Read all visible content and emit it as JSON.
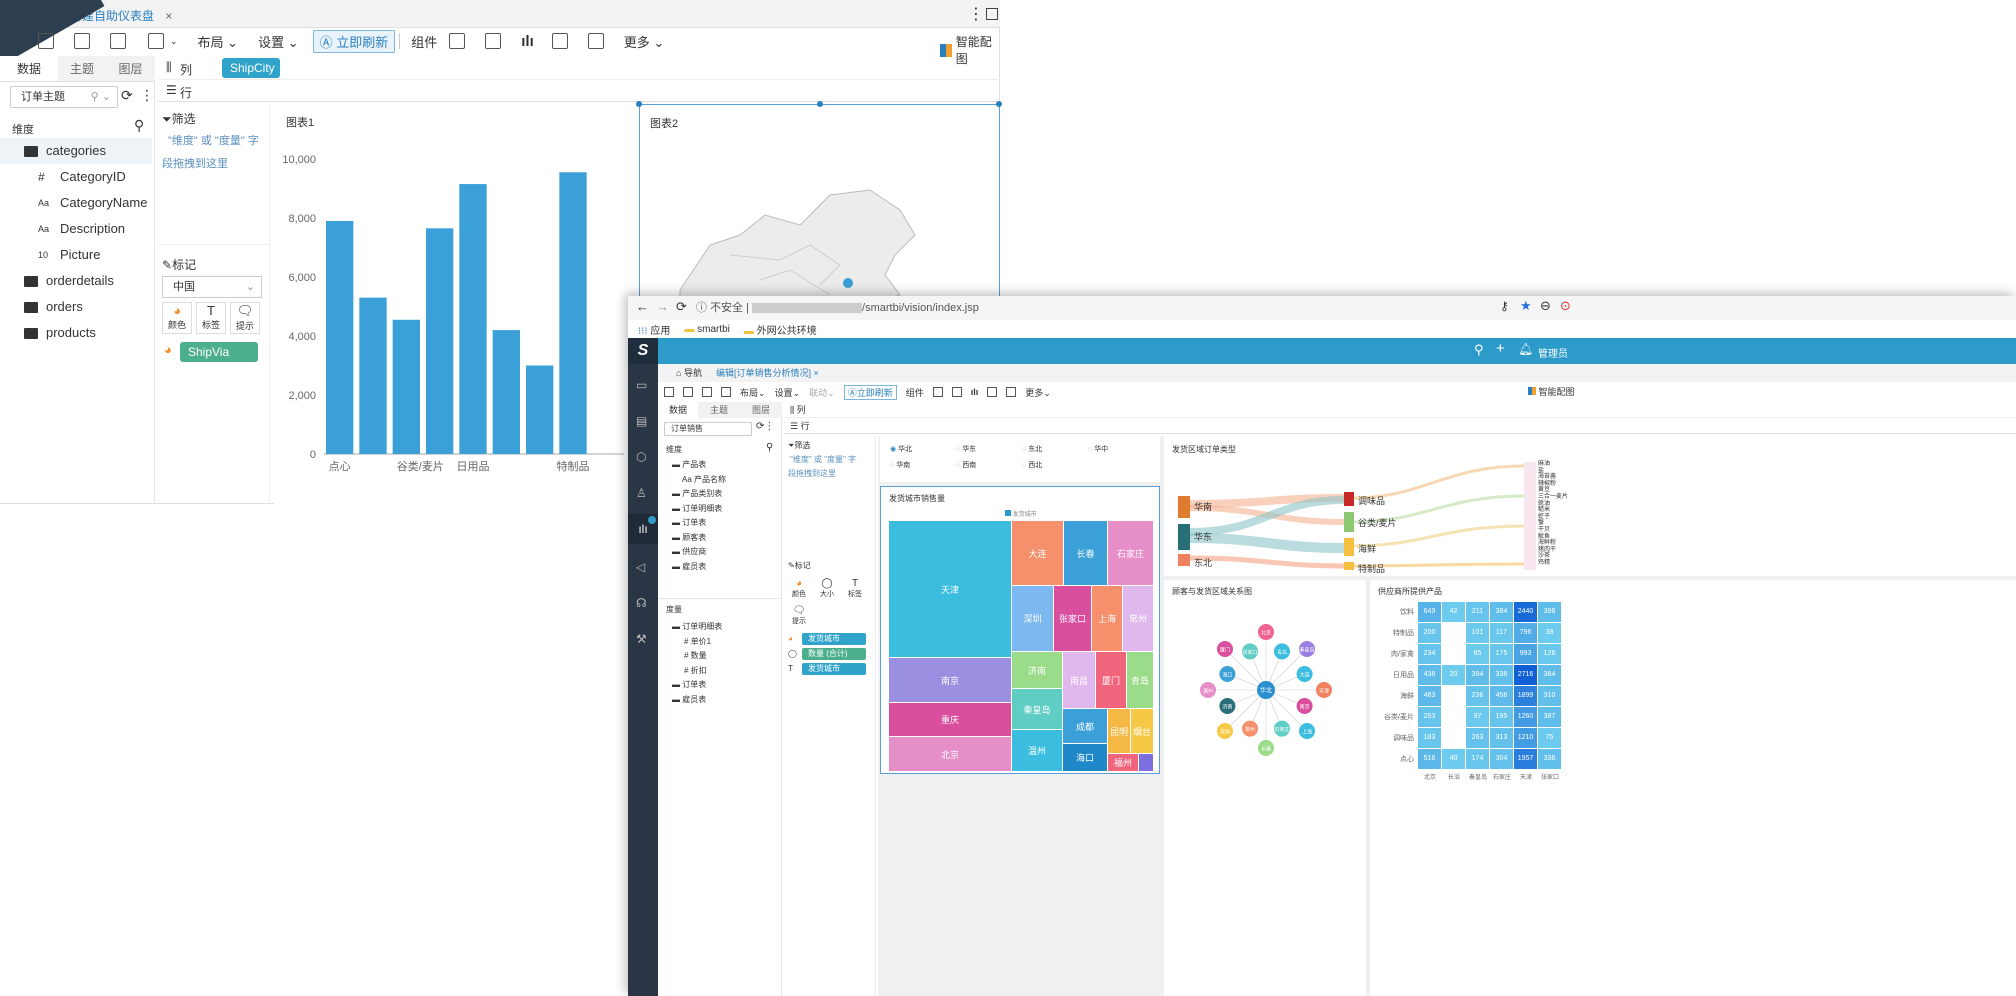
{
  "w1": {
    "tab": "新建自助仪表盘",
    "tab_close": "×",
    "toolbar": {
      "layout": "布局",
      "settings": "设置",
      "refresh": "立即刷新",
      "component": "组件",
      "more": "更多",
      "smart": "智能配图"
    },
    "left_tabs": [
      "数据",
      "主题",
      "图层"
    ],
    "topic": "订单主题",
    "dim_title": "维度",
    "tree": [
      {
        "label": "categories",
        "type": "folder"
      },
      {
        "label": "CategoryID",
        "type": "#"
      },
      {
        "label": "CategoryName",
        "type": "Aa"
      },
      {
        "label": "Description",
        "type": "Aa"
      },
      {
        "label": "Picture",
        "type": "10"
      },
      {
        "label": "orderdetails",
        "type": "folder"
      },
      {
        "label": "orders",
        "type": "folder"
      },
      {
        "label": "products",
        "type": "folder"
      }
    ],
    "cols_label": "列",
    "rows_label": "行",
    "col_pill": "ShipCity",
    "filter": {
      "title": "筛选",
      "hint1": "\"维度\" 或 \"度量\" 字",
      "hint2": "段拖拽到这里"
    },
    "mark": {
      "title": "标记",
      "select": "中国",
      "buttons": [
        "颜色",
        "标签",
        "提示"
      ],
      "pill": "ShipVia (合..."
    },
    "chart1_title": "图表1",
    "chart2_title": "图表2"
  },
  "chart_data": {
    "type": "bar",
    "categories": [
      "点心",
      "",
      "谷类/麦片",
      "",
      "日用品",
      "",
      "",
      "特制品",
      ""
    ],
    "values": [
      7900,
      5300,
      4550,
      7650,
      9150,
      4200,
      3000,
      9550,
      0
    ],
    "ylim": [
      0,
      10000
    ],
    "yticks": [
      "10,000",
      "8,000",
      "6,000",
      "4,000",
      "2,000",
      "0"
    ],
    "color": "#3ba0d8"
  },
  "browser": {
    "security": "不安全",
    "url": "/smartbi/vision/index.jsp",
    "bookmarks": [
      "应用",
      "smartbi",
      "外网公共环境"
    ]
  },
  "w2": {
    "header_right": "管理员",
    "nav": "导航",
    "tab": "编辑[订单销售分析情况]",
    "toolbar": {
      "layout": "布局",
      "settings": "设置",
      "linkage": "联动",
      "refresh": "立即刷新",
      "component": "组件",
      "more": "更多",
      "smart": "智能配图"
    },
    "left_tabs": [
      "数据",
      "主题",
      "图层"
    ],
    "topic": "订单销售",
    "dim_title": "维度",
    "tree": [
      "产品表",
      "产品名称",
      "产品类别表",
      "订单明细表",
      "订单表",
      "顾客表",
      "供应商",
      "雇员表"
    ],
    "measure_title": "度量",
    "mtree": [
      "订单明细表",
      "单价1",
      "数量",
      "折扣",
      "订单表",
      "雇员表"
    ],
    "cols_label": "列",
    "rows_label": "行",
    "filter": {
      "title": "筛选",
      "hint1": "\"维度\" 或 \"度量\" 字",
      "hint2": "段拖拽到这里"
    },
    "mark": {
      "title": "标记",
      "buttons": [
        "颜色",
        "大小",
        "标签",
        "提示"
      ],
      "pills": [
        "发货城市",
        "数量 (合计)",
        "发货城市"
      ]
    },
    "regions": [
      "华北",
      "华东",
      "东北",
      "华中",
      "华南",
      "西南",
      "西北"
    ],
    "treemap": {
      "title": "发货城市销售量",
      "legend": "发货城市",
      "cells": [
        "天津",
        "南京",
        "重庆",
        "北京",
        "大连",
        "长春",
        "石家庄",
        "深圳",
        "张家口",
        "上海",
        "常州",
        "济南",
        "秦皇岛",
        "南昌",
        "厦门",
        "青岛",
        "温州",
        "成都",
        "海口",
        "昆明",
        "烟台",
        "福州"
      ]
    },
    "sankey": {
      "title": "发货区域订单类型",
      "left": [
        "华南",
        "华东",
        "东北"
      ],
      "mid": [
        "调味品",
        "谷类/麦片",
        "海鲜",
        "特制品"
      ],
      "right": [
        "麻油",
        "盐",
        "海苔酱",
        "辣椒粉",
        "黄豆",
        "三合一麦片",
        "蚝油",
        "糙米",
        "虾子",
        "蟹",
        "干贝",
        "鱿鱼",
        "海鲜粉",
        "猪肉干",
        "沙茶",
        "鸡精"
      ]
    },
    "graph": {
      "title": "顾客与发货区域关系图",
      "center": "华北",
      "nodes": [
        "北京",
        "青岛",
        "秦皇岛",
        "大连",
        "天津",
        "南京",
        "上海",
        "石家庄",
        "长春",
        "常州",
        "深圳",
        "济南",
        "温州",
        "海口",
        "厦门",
        "张家口"
      ]
    },
    "heatmap": {
      "title": "供应商所提供产品",
      "rows": [
        [
          "饮料",
          "649",
          "42",
          "211",
          "384",
          "2440",
          "398"
        ],
        [
          "特制品",
          "200",
          "",
          "101",
          "117",
          "796",
          "38"
        ],
        [
          "肉/家禽",
          "234",
          "",
          "65",
          "175",
          "993",
          "126"
        ],
        [
          "日用品",
          "438",
          "20",
          "394",
          "338",
          "2716",
          "384"
        ],
        [
          "海鲜",
          "483",
          "",
          "236",
          "456",
          "1899",
          "310"
        ],
        [
          "谷类/麦片",
          "253",
          "",
          "97",
          "195",
          "1260",
          "387"
        ],
        [
          "调味品",
          "183",
          "",
          "263",
          "313",
          "1210",
          "75"
        ],
        [
          "点心",
          "516",
          "40",
          "174",
          "304",
          "1957",
          "336"
        ]
      ],
      "cols": [
        "北京",
        "长治",
        "秦皇岛",
        "石家庄",
        "天津",
        "张家口"
      ]
    }
  }
}
